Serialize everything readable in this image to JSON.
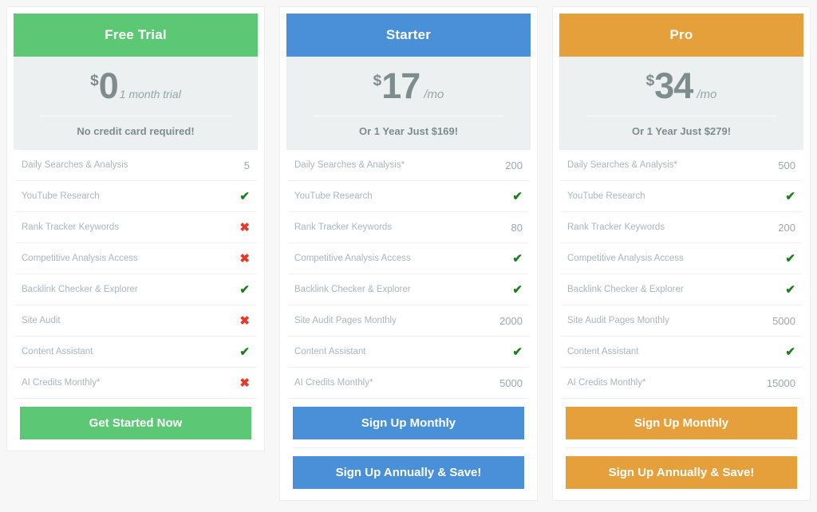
{
  "colors": {
    "free": "#5cc876",
    "starter": "#4a90d9",
    "pro": "#e5a03c",
    "check": "#1e7e1e",
    "cross": "#e8382a"
  },
  "glyphs": {
    "check": "✔",
    "cross": "✖",
    "currency": "$"
  },
  "plans": [
    {
      "name": "Free Trial",
      "amount": "0",
      "currency": "$",
      "period": "1 month trial",
      "period_style": "trial",
      "note": "No credit card required!",
      "features": [
        {
          "label": "Daily Searches & Analysis",
          "value": "5",
          "kind": "text"
        },
        {
          "label": "YouTube Research",
          "value": "✔",
          "kind": "check"
        },
        {
          "label": "Rank Tracker Keywords",
          "value": "✖",
          "kind": "cross"
        },
        {
          "label": "Competitive Analysis Access",
          "value": "✖",
          "kind": "cross"
        },
        {
          "label": "Backlink Checker & Explorer",
          "value": "✔",
          "kind": "check"
        },
        {
          "label": "Site Audit",
          "value": "✖",
          "kind": "cross"
        },
        {
          "label": "Content Assistant",
          "value": "✔",
          "kind": "check"
        },
        {
          "label": "AI Credits Monthly*",
          "value": "✖",
          "kind": "cross"
        }
      ],
      "buttons": [
        {
          "label": "Get Started Now",
          "name": "get-started-now-button"
        }
      ]
    },
    {
      "name": "Starter",
      "amount": "17",
      "currency": "$",
      "period": "/mo",
      "period_style": "mo",
      "note": "Or 1 Year Just $169!",
      "features": [
        {
          "label": "Daily Searches & Analysis*",
          "value": "200",
          "kind": "text"
        },
        {
          "label": "YouTube Research",
          "value": "✔",
          "kind": "check"
        },
        {
          "label": "Rank Tracker Keywords",
          "value": "80",
          "kind": "text"
        },
        {
          "label": "Competitive Analysis Access",
          "value": "✔",
          "kind": "check"
        },
        {
          "label": "Backlink Checker & Explorer",
          "value": "✔",
          "kind": "check"
        },
        {
          "label": "Site Audit Pages Monthly",
          "value": "2000",
          "kind": "text"
        },
        {
          "label": "Content Assistant",
          "value": "✔",
          "kind": "check"
        },
        {
          "label": "AI Credits Monthly*",
          "value": "5000",
          "kind": "text"
        }
      ],
      "buttons": [
        {
          "label": "Sign Up Monthly",
          "name": "sign-up-monthly-button"
        },
        {
          "label": "Sign Up Annually & Save!",
          "name": "sign-up-annually-button"
        }
      ]
    },
    {
      "name": "Pro",
      "amount": "34",
      "currency": "$",
      "period": "/mo",
      "period_style": "mo",
      "note": "Or 1 Year Just $279!",
      "features": [
        {
          "label": "Daily Searches & Analysis*",
          "value": "500",
          "kind": "text"
        },
        {
          "label": "YouTube Research",
          "value": "✔",
          "kind": "check"
        },
        {
          "label": "Rank Tracker Keywords",
          "value": "200",
          "kind": "text"
        },
        {
          "label": "Competitive Analysis Access",
          "value": "✔",
          "kind": "check"
        },
        {
          "label": "Backlink Checker & Explorer",
          "value": "✔",
          "kind": "check"
        },
        {
          "label": "Site Audit Pages Monthly",
          "value": "5000",
          "kind": "text"
        },
        {
          "label": "Content Assistant",
          "value": "✔",
          "kind": "check"
        },
        {
          "label": "AI Credits Monthly*",
          "value": "15000",
          "kind": "text"
        }
      ],
      "buttons": [
        {
          "label": "Sign Up Monthly",
          "name": "sign-up-monthly-button"
        },
        {
          "label": "Sign Up Annually & Save!",
          "name": "sign-up-annually-button"
        }
      ]
    }
  ]
}
